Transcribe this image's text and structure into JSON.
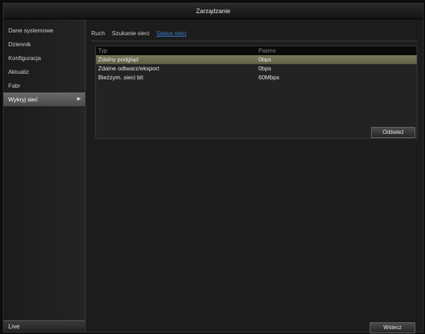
{
  "window": {
    "title": "Zarządzanie"
  },
  "sidebar": {
    "items": [
      {
        "label": "Dane systemowe",
        "active": false
      },
      {
        "label": "Dziennik",
        "active": false
      },
      {
        "label": "Konfiguracja",
        "active": false
      },
      {
        "label": "Aktualiz",
        "active": false
      },
      {
        "label": "Fabr",
        "active": false
      },
      {
        "label": "Wykryj sieć",
        "active": true
      }
    ],
    "live_label": "Live"
  },
  "tabs": [
    {
      "label": "Ruch",
      "active": false
    },
    {
      "label": "Szukanie sieci",
      "active": false
    },
    {
      "label": "Status sieci",
      "active": true
    }
  ],
  "table": {
    "columns": [
      "Typ",
      "Pasmo"
    ],
    "rows": [
      {
        "type": "Zdalny podgląd",
        "bandwidth": "0bps",
        "selected": true
      },
      {
        "type": "Zdalne odtwarz/eksport",
        "bandwidth": "0bps",
        "selected": false
      },
      {
        "type": "Bieżzym. sieci bit",
        "bandwidth": "60Mbps",
        "selected": false
      }
    ]
  },
  "buttons": {
    "refresh": "Odśwież",
    "back": "Wstecz"
  }
}
